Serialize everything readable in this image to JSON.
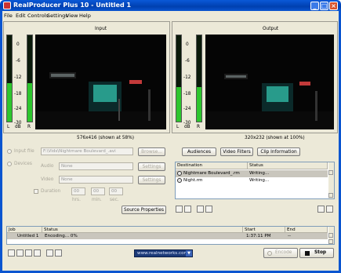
{
  "window": {
    "title": "RealProducer Plus 10 - Untitled 1"
  },
  "menu": [
    "File",
    "Edit",
    "Controls",
    "Settings",
    "View",
    "Help"
  ],
  "input_panel": {
    "label": "Input",
    "caption": "576x416 (shown at 58%)"
  },
  "output_panel": {
    "label": "Output",
    "caption": "320x232 (shown at 100%)"
  },
  "meter": {
    "scale": [
      "0",
      "-6",
      "-12",
      "-18",
      "-24",
      "-30"
    ],
    "footer": [
      "L",
      "dB",
      "R"
    ],
    "input_level": 0.45,
    "output_level": 0.4
  },
  "source": {
    "input_file_label": "Input file",
    "input_file_value": "F:\\Vids\\Nightmare Boulevard_.avi",
    "browse_label": "Browse...",
    "devices_label": "Devices",
    "audio_label": "Audio",
    "audio_value": "None",
    "video_label": "Video",
    "video_value": "None",
    "settings_label": "Settings",
    "duration_label": "Duration",
    "duration_values": [
      "00",
      "00",
      "00"
    ],
    "duration_units": [
      "hrs.",
      "min.",
      "sec."
    ],
    "source_properties_label": "Source Properties"
  },
  "dest": {
    "audiences_label": "Audiences",
    "video_filters_label": "Video Filters",
    "clip_information_label": "Clip Information",
    "columns": [
      "Destination",
      "Status"
    ],
    "rows": [
      {
        "destination": "Nightmare Boulevard_.rm",
        "status": "Writing..."
      },
      {
        "destination": "Night.rm",
        "status": "Writing..."
      }
    ]
  },
  "jobs": {
    "columns": [
      "Job",
      "Status",
      "Start",
      "End"
    ],
    "rows": [
      {
        "job": "Untitled 1",
        "status": "Encoding... 0%",
        "start": "1:37:11 PM",
        "end": "--"
      }
    ]
  },
  "footer": {
    "site_label": "www.realnetworks.com",
    "encode_label": "Encode",
    "stop_label": "Stop"
  },
  "colors": {
    "title_bar": "#0a55d0",
    "meter_green": "#2dc62d",
    "window_bg": "#ece9d8"
  }
}
